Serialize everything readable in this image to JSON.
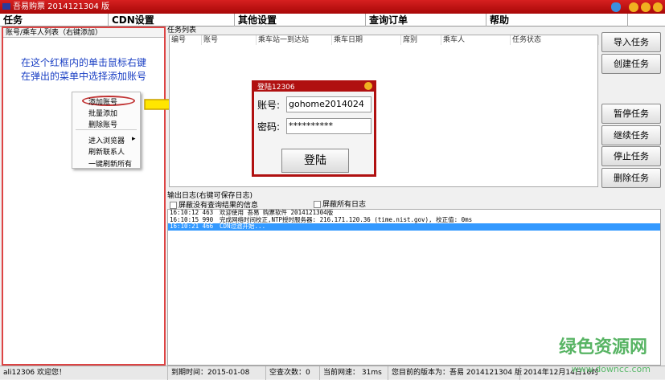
{
  "window": {
    "title": "吾易购票 2014121304 版"
  },
  "menu": [
    "任务",
    "CDN设置",
    "其他设置",
    "查询订单",
    "帮助"
  ],
  "left_panel": {
    "header": "账号/乘车人列表（右键添加）",
    "hint_line1": "在这个红框内的单击鼠标右键",
    "hint_line2": "在弹出的菜单中选择添加账号"
  },
  "context_menu": [
    "添加账号",
    "批量添加",
    "删除账号",
    "进入浏览器",
    "刷新联系人",
    "一键刷新所有"
  ],
  "tasks": {
    "label": "任务列表",
    "columns": [
      "编号",
      "账号",
      "乘车站一到达站",
      "乘车日期",
      "席别",
      "乘车人",
      "任务状态"
    ]
  },
  "buttons": [
    "导入任务",
    "创建任务",
    "暂停任务",
    "继续任务",
    "停止任务",
    "删除任务"
  ],
  "log": {
    "label": "输出日志(右键可保存日志)",
    "cb1": "屏蔽没有查询结果的信息",
    "cb2": "屏蔽所有日志",
    "rows": [
      {
        "time": "16:10:12 463",
        "msg": "欢迎使用 吾易 购票软件 2014121304版"
      },
      {
        "time": "16:10:15 990",
        "msg": "完成网络时间校正,NTP授时服务器: 216.171.120.36 (time.nist.gov), 校正值: 0ms"
      },
      {
        "time": "16:10:21 466",
        "msg": "CDN过滤开始..."
      }
    ]
  },
  "login": {
    "title": "登陆12306",
    "user_label": "账号:",
    "user_value": "gohome2014024",
    "pass_label": "密码:",
    "pass_value": "**********",
    "submit": "登陆"
  },
  "status": {
    "user": "ali12306 欢迎您！",
    "expire": "到期时间：2015-01-08",
    "empty": "空查次数：0",
    "speed": "当前网速：  31ms",
    "version": "您目前的版本为：吾易 2014121304 版",
    "date": "2014年12月14日16时"
  },
  "watermark": {
    "name": "绿色资源网",
    "url": "www.downcc.com"
  },
  "colors": {
    "title": "#c01818",
    "border": "#d44444",
    "hint": "#1a3fc4",
    "selected": "#3399ff"
  }
}
